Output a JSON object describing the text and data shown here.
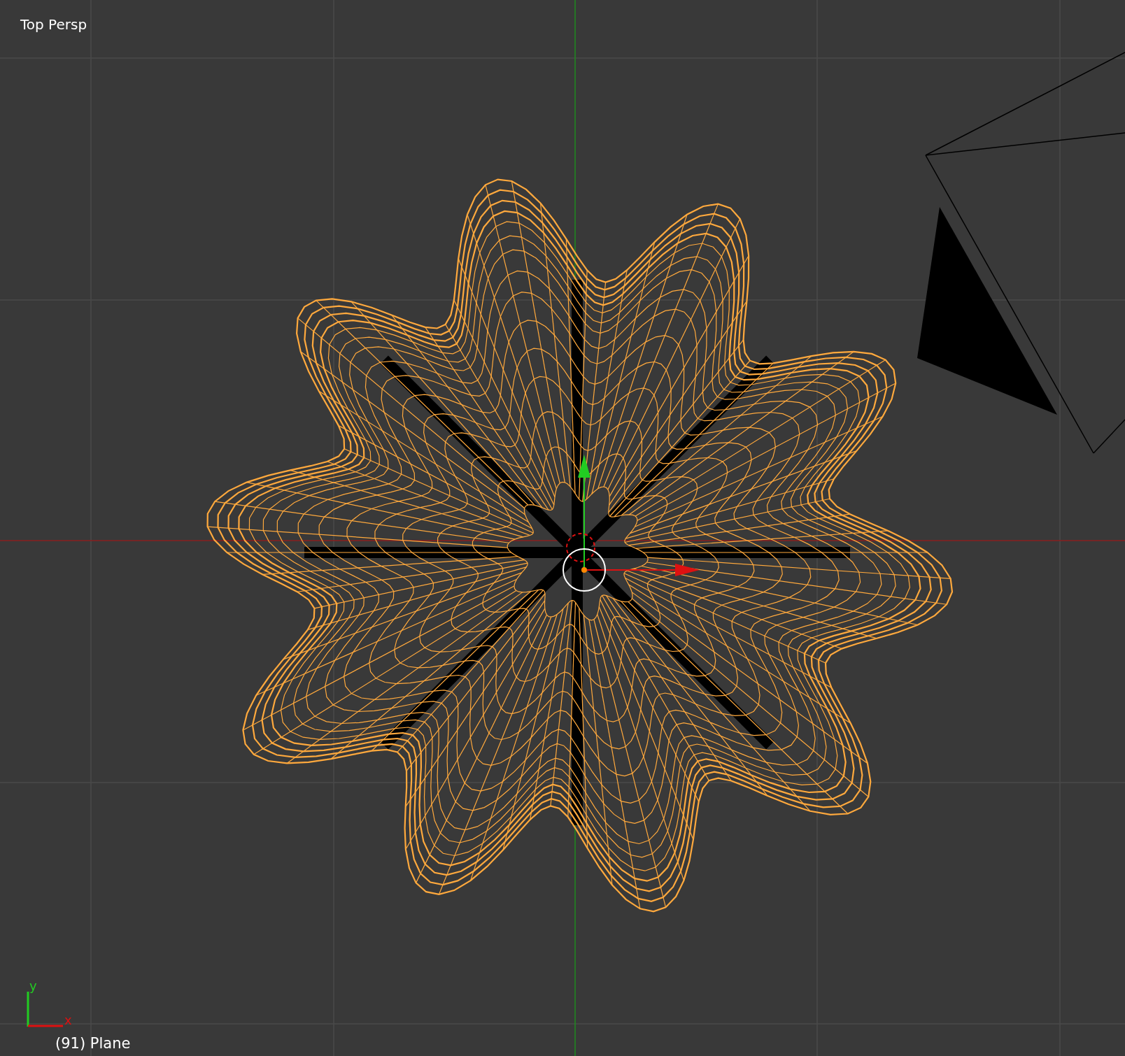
{
  "viewport": {
    "view_label": "Top Persp",
    "object_info": "(91) Plane"
  },
  "axis_widget": {
    "y_label": "y",
    "x_label": "x"
  }
}
